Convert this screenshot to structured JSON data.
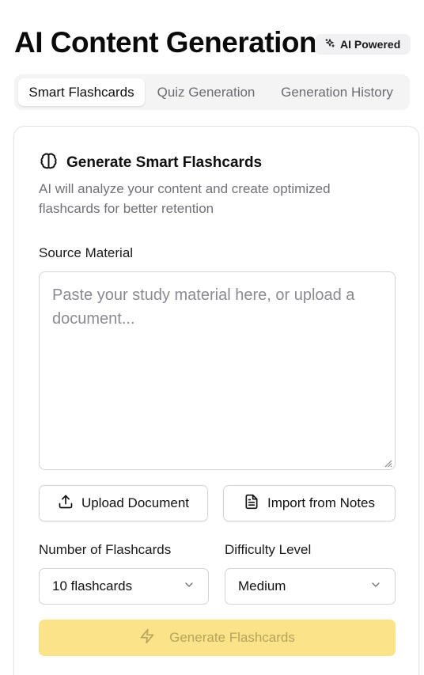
{
  "header": {
    "title": "AI Content Generation",
    "badge": "AI Powered"
  },
  "tabs": [
    {
      "label": "Smart Flashcards",
      "active": true
    },
    {
      "label": "Quiz Generation",
      "active": false
    },
    {
      "label": "Generation History",
      "active": false
    }
  ],
  "card": {
    "title": "Generate Smart Flashcards",
    "description": "AI will analyze your content and create optimized flashcards for better retention",
    "source_label": "Source Material",
    "source_value": "",
    "source_placeholder": "Paste your study material here, or upload a document...",
    "upload_label": "Upload Document",
    "import_label": "Import from Notes",
    "count_label": "Number of Flashcards",
    "count_value": "10 flashcards",
    "difficulty_label": "Difficulty Level",
    "difficulty_value": "Medium",
    "generate_label": "Generate Flashcards"
  },
  "icons": {
    "badge": "sparkles-icon",
    "card": "brain-icon",
    "upload": "upload-icon",
    "import": "document-icon",
    "select": "chevron-down-icon",
    "generate": "zap-icon"
  },
  "colors": {
    "accent": "#fbe38a",
    "accent_text": "#b8a35c",
    "muted_text": "#71717a",
    "border": "#d4d4d8"
  }
}
